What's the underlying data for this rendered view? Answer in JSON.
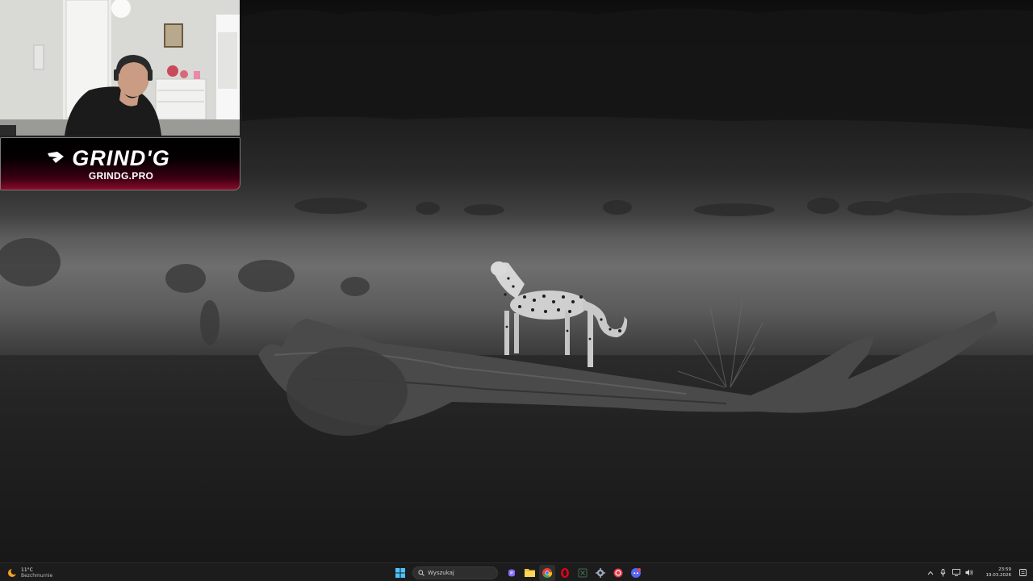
{
  "stream_overlay": {
    "brand_title": "GRIND'G",
    "brand_url": "GRINDG.PRO",
    "brand_color": "#8a0c2d"
  },
  "taskbar": {
    "weather": {
      "temperature": "11°C",
      "condition": "Bezchmurnie",
      "icon": "sun-moon-icon"
    },
    "search_placeholder": "Wyszukaj",
    "apps": [
      {
        "name": "start",
        "icon": "windows-logo-icon",
        "color": "#4cc2ff"
      },
      {
        "name": "copilot",
        "icon": "copilot-icon",
        "color": "#8a6cff"
      },
      {
        "name": "file-explorer",
        "icon": "folder-icon",
        "color": "#f3c13a"
      },
      {
        "name": "chrome",
        "icon": "chrome-icon",
        "color": "#e94235"
      },
      {
        "name": "opera",
        "icon": "opera-icon",
        "color": "#e3001b"
      },
      {
        "name": "excel",
        "icon": "excel-icon",
        "color": "#1f7a45"
      },
      {
        "name": "settings",
        "icon": "gear-icon",
        "color": "#9aa7b8"
      },
      {
        "name": "app-red",
        "icon": "app-icon",
        "color": "#e63946"
      },
      {
        "name": "discord",
        "icon": "discord-icon",
        "color": "#5865f2"
      }
    ],
    "clock": {
      "time": "23:59",
      "date": "19.03.2026"
    }
  }
}
